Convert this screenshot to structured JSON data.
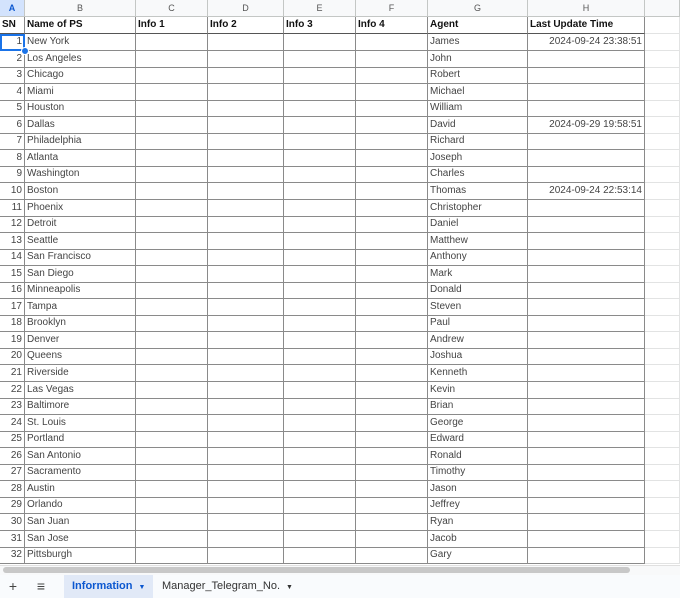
{
  "columns": [
    "A",
    "B",
    "C",
    "D",
    "E",
    "F",
    "G",
    "H"
  ],
  "selected_column": "A",
  "headers": [
    "SN",
    "Name of PS",
    "Info 1",
    "Info 2",
    "Info 3",
    "Info 4",
    "Agent",
    "Last Update Time"
  ],
  "rows": [
    [
      "1",
      "New York",
      "",
      "",
      "",
      "",
      "James",
      "2024-09-24 23:38:51"
    ],
    [
      "2",
      "Los Angeles",
      "",
      "",
      "",
      "",
      "John",
      ""
    ],
    [
      "3",
      "Chicago",
      "",
      "",
      "",
      "",
      "Robert",
      ""
    ],
    [
      "4",
      "Miami",
      "",
      "",
      "",
      "",
      "Michael",
      ""
    ],
    [
      "5",
      "Houston",
      "",
      "",
      "",
      "",
      "William",
      ""
    ],
    [
      "6",
      "Dallas",
      "",
      "",
      "",
      "",
      "David",
      "2024-09-29 19:58:51"
    ],
    [
      "7",
      "Philadelphia",
      "",
      "",
      "",
      "",
      "Richard",
      ""
    ],
    [
      "8",
      "Atlanta",
      "",
      "",
      "",
      "",
      "Joseph",
      ""
    ],
    [
      "9",
      "Washington",
      "",
      "",
      "",
      "",
      "Charles",
      ""
    ],
    [
      "10",
      "Boston",
      "",
      "",
      "",
      "",
      "Thomas",
      "2024-09-24 22:53:14"
    ],
    [
      "11",
      "Phoenix",
      "",
      "",
      "",
      "",
      "Christopher",
      ""
    ],
    [
      "12",
      "Detroit",
      "",
      "",
      "",
      "",
      "Daniel",
      ""
    ],
    [
      "13",
      "Seattle",
      "",
      "",
      "",
      "",
      "Matthew",
      ""
    ],
    [
      "14",
      "San Francisco",
      "",
      "",
      "",
      "",
      "Anthony",
      ""
    ],
    [
      "15",
      "San Diego",
      "",
      "",
      "",
      "",
      "Mark",
      ""
    ],
    [
      "16",
      "Minneapolis",
      "",
      "",
      "",
      "",
      "Donald",
      ""
    ],
    [
      "17",
      "Tampa",
      "",
      "",
      "",
      "",
      "Steven",
      ""
    ],
    [
      "18",
      "Brooklyn",
      "",
      "",
      "",
      "",
      "Paul",
      ""
    ],
    [
      "19",
      "Denver",
      "",
      "",
      "",
      "",
      "Andrew",
      ""
    ],
    [
      "20",
      "Queens",
      "",
      "",
      "",
      "",
      "Joshua",
      ""
    ],
    [
      "21",
      "Riverside",
      "",
      "",
      "",
      "",
      "Kenneth",
      ""
    ],
    [
      "22",
      "Las Vegas",
      "",
      "",
      "",
      "",
      "Kevin",
      ""
    ],
    [
      "23",
      "Baltimore",
      "",
      "",
      "",
      "",
      "Brian",
      ""
    ],
    [
      "24",
      "St. Louis",
      "",
      "",
      "",
      "",
      "George",
      ""
    ],
    [
      "25",
      "Portland",
      "",
      "",
      "",
      "",
      "Edward",
      ""
    ],
    [
      "26",
      "San Antonio",
      "",
      "",
      "",
      "",
      "Ronald",
      ""
    ],
    [
      "27",
      "Sacramento",
      "",
      "",
      "",
      "",
      "Timothy",
      ""
    ],
    [
      "28",
      "Austin",
      "",
      "",
      "",
      "",
      "Jason",
      ""
    ],
    [
      "29",
      "Orlando",
      "",
      "",
      "",
      "",
      "Jeffrey",
      ""
    ],
    [
      "30",
      "San Juan",
      "",
      "",
      "",
      "",
      "Ryan",
      ""
    ],
    [
      "31",
      "San Jose",
      "",
      "",
      "",
      "",
      "Jacob",
      ""
    ],
    [
      "32",
      "Pittsburgh",
      "",
      "",
      "",
      "",
      "Gary",
      ""
    ]
  ],
  "tabbar": {
    "add_icon": "+",
    "menu_icon": "≡",
    "sheets": [
      {
        "label": "Information",
        "active": true
      },
      {
        "label": "Manager_Telegram_No.",
        "active": false
      }
    ],
    "caret": "▼"
  },
  "colors": {
    "accent": "#1a73e8",
    "active_tab_bg": "#e1e9f7",
    "active_tab_text": "#0b57d0"
  }
}
